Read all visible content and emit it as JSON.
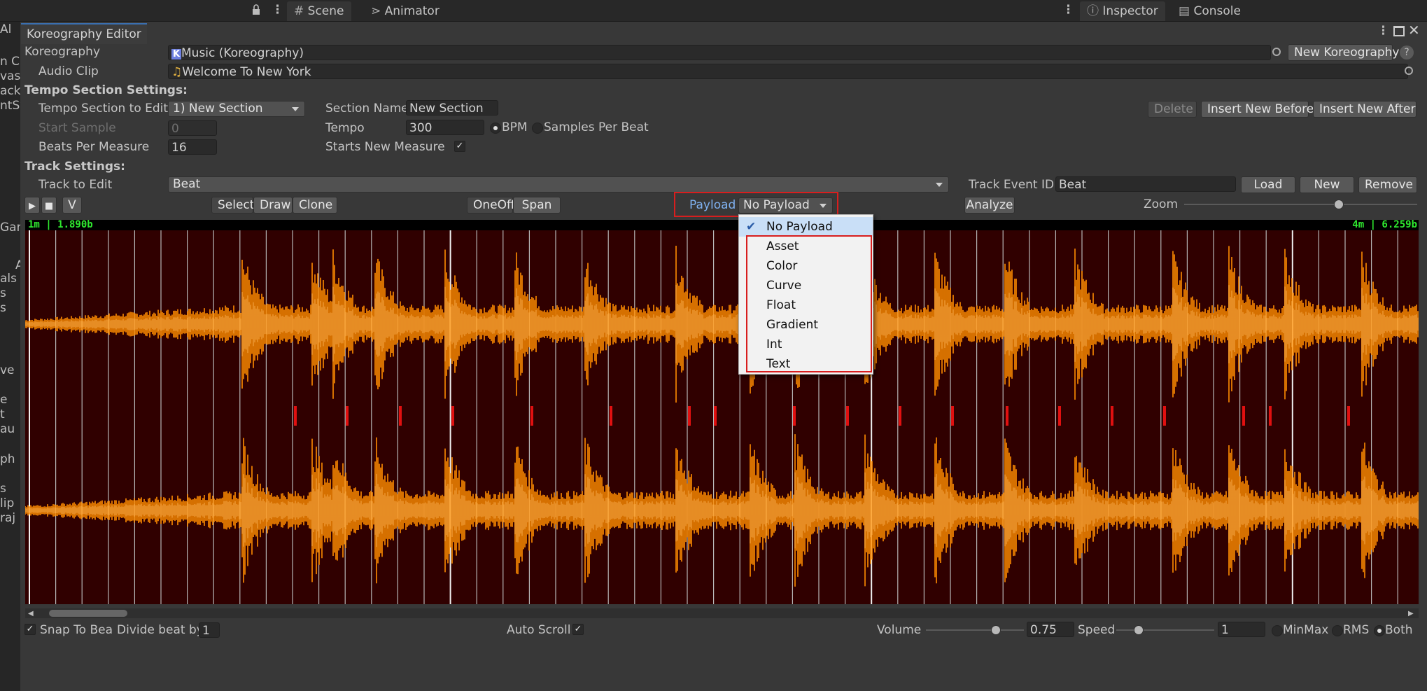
{
  "topbar": {
    "tabs": [
      {
        "label": "Scene",
        "icon": "grid-icon"
      },
      {
        "label": "Animator",
        "icon": "animator-icon"
      },
      {
        "label": "Inspector",
        "icon": "info-icon"
      },
      {
        "label": "Console",
        "icon": "console-icon"
      }
    ]
  },
  "left_strip": [
    "Al",
    "n Ca",
    "vas",
    "ackg",
    "ntSy",
    "Gar",
    "A",
    "als",
    "s",
    "s",
    "ve",
    "e",
    "t",
    "au",
    "ph",
    "s",
    "lip",
    "raj"
  ],
  "window": {
    "title": "Koreography Editor"
  },
  "koreography": {
    "label": "Koreography",
    "value": "Music (Koreography)",
    "icon_letter": "K",
    "new_button": "New Koreography",
    "help": "?"
  },
  "audio_clip": {
    "label": "Audio Clip",
    "value": "Welcome To New York"
  },
  "tempo": {
    "header": "Tempo Section Settings:",
    "section_to_edit_label": "Tempo Section to Edit",
    "section_to_edit_value": "1) New Section",
    "section_name_label": "Section Name",
    "section_name_value": "New Section",
    "start_sample_label": "Start Sample",
    "start_sample_value": "0",
    "tempo_label": "Tempo",
    "tempo_value": "300",
    "bpm_label": "BPM",
    "samples_per_beat_label": "Samples Per Beat",
    "beats_per_measure_label": "Beats Per Measure",
    "beats_per_measure_value": "16",
    "starts_new_measure_label": "Starts New Measure",
    "delete_button": "Delete",
    "insert_before_button": "Insert New Before",
    "insert_after_button": "Insert New After"
  },
  "track": {
    "header": "Track Settings:",
    "track_to_edit_label": "Track to Edit",
    "track_to_edit_value": "Beat",
    "event_id_label": "Track Event ID",
    "event_id_value": "Beat",
    "load_button": "Load",
    "new_button": "New",
    "remove_button": "Remove"
  },
  "toolbar": {
    "v_button": "V",
    "select": "Select",
    "draw": "Draw",
    "clone": "Clone",
    "oneoff": "OneOff",
    "span": "Span",
    "payload_label": "Payload",
    "payload_value": "No Payload",
    "analyze": "Analyze",
    "zoom_label": "Zoom"
  },
  "payload_menu": [
    "No Payload",
    "Asset",
    "Color",
    "Curve",
    "Float",
    "Gradient",
    "Int",
    "Text"
  ],
  "waveform": {
    "start_time": "1m | 1.890b",
    "end_time": "4m | 6.259b",
    "bg_color": "#300000",
    "wave_color": "#ff8c00",
    "wave_light": "#ffa533"
  },
  "bottom": {
    "snap_label": "Snap To Bea",
    "divide_label": "Divide beat by",
    "divide_value": "1",
    "autoscroll_label": "Auto Scroll",
    "volume_label": "Volume",
    "volume_value": "0.75",
    "speed_label": "Speed",
    "speed_value": "1",
    "minmax_label": "MinMax",
    "rms_label": "RMS",
    "both_label": "Both"
  }
}
